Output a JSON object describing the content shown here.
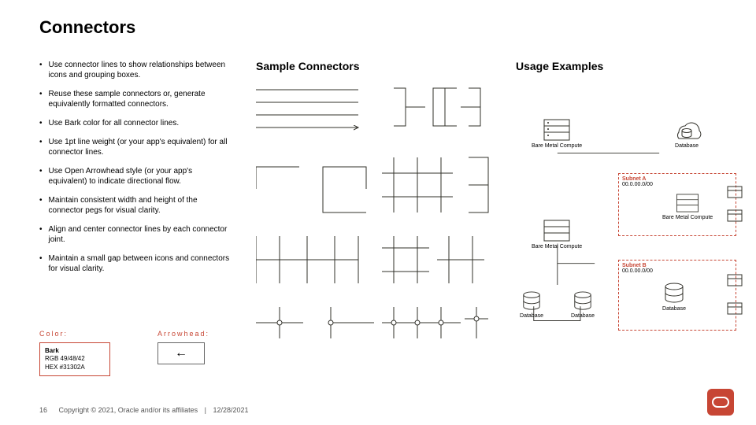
{
  "title": "Connectors",
  "bullets": [
    "Use connector lines to show relationships between icons and grouping boxes.",
    "Reuse these sample connectors or, generate equivalently formatted connectors.",
    "Use Bark color for all connector lines.",
    "Use 1pt line weight (or your app's equivalent) for all connector lines.",
    "Use Open Arrowhead style (or your app's equivalent) to indicate directional flow.",
    "Maintain consistent width and height of the connector pegs for visual clarity.",
    "Align and center connector lines by each connector joint.",
    "Maintain a small gap between icons and connectors for visual clarity."
  ],
  "sample_head": "Sample Connectors",
  "usage_head": "Usage Examples",
  "color_label": "Color:",
  "color_box": {
    "name": "Bark",
    "rgb": "RGB 49/48/42",
    "hex": "HEX #31302A"
  },
  "arrow_label": "Arrowhead:",
  "arrow_glyph": "←",
  "labels": {
    "bmc": "Bare Metal Compute",
    "db": "Database",
    "subnetA": {
      "name": "Subnet A",
      "cidr": "00.0.00.0/00"
    },
    "subnetB": {
      "name": "Subnet B",
      "cidr": "00.0.00.0/00"
    }
  },
  "footer": {
    "page": "16",
    "copy": "Copyright © 2021, Oracle and/or its affiliates",
    "date": "12/28/2021"
  }
}
